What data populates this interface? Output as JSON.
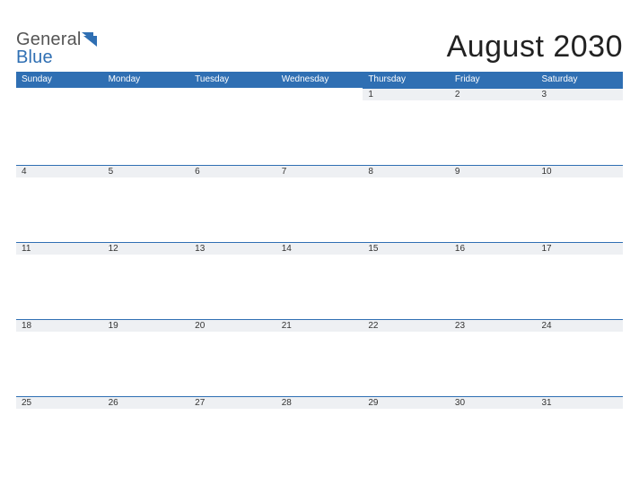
{
  "brand": {
    "word1": "General",
    "word2": "Blue"
  },
  "title": "August 2030",
  "day_headers": [
    "Sunday",
    "Monday",
    "Tuesday",
    "Wednesday",
    "Thursday",
    "Friday",
    "Saturday"
  ],
  "weeks": [
    [
      "",
      "",
      "",
      "",
      "1",
      "2",
      "3"
    ],
    [
      "4",
      "5",
      "6",
      "7",
      "8",
      "9",
      "10"
    ],
    [
      "11",
      "12",
      "13",
      "14",
      "15",
      "16",
      "17"
    ],
    [
      "18",
      "19",
      "20",
      "21",
      "22",
      "23",
      "24"
    ],
    [
      "25",
      "26",
      "27",
      "28",
      "29",
      "30",
      "31"
    ]
  ]
}
